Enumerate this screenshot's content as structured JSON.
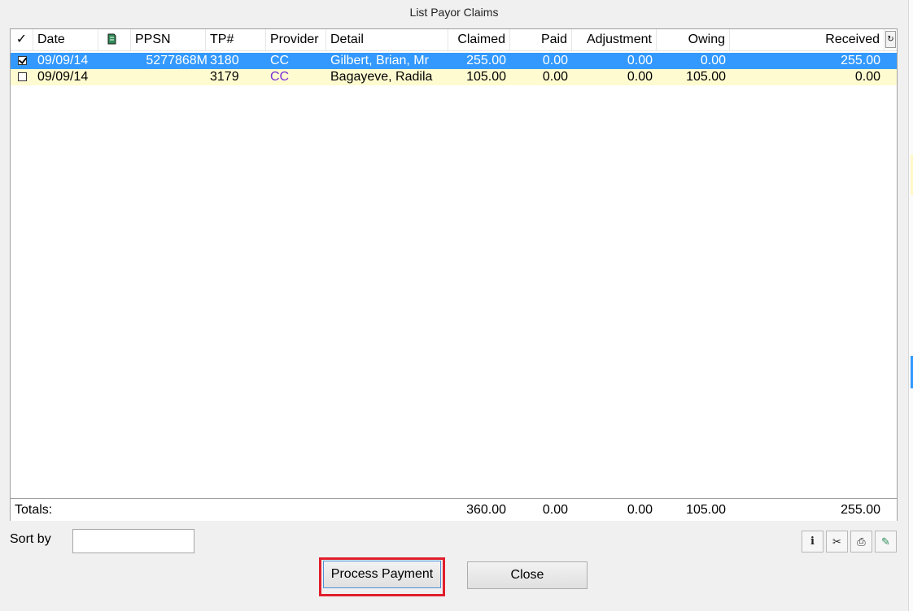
{
  "window": {
    "title": "List Payor Claims"
  },
  "columns": {
    "check": "✓",
    "date": "Date",
    "icon": "note-icon",
    "ppsn": "PPSN",
    "tp": "TP#",
    "provider": "Provider",
    "detail": "Detail",
    "claimed": "Claimed",
    "paid": "Paid",
    "adjustment": "Adjustment",
    "owing": "Owing",
    "received": "Received"
  },
  "rows": [
    {
      "checked": true,
      "date": "09/09/14",
      "ppsn": "5277868M",
      "tp": "3180",
      "provider": "CC",
      "detail": "Gilbert, Brian, Mr",
      "claimed": "255.00",
      "paid": "0.00",
      "adjustment": "0.00",
      "owing": "0.00",
      "received": "255.00",
      "selected": true
    },
    {
      "checked": false,
      "date": "09/09/14",
      "ppsn": "",
      "tp": "3179",
      "provider": "CC",
      "detail": "Bagayeve, Radila",
      "claimed": "105.00",
      "paid": "0.00",
      "adjustment": "0.00",
      "owing": "105.00",
      "received": "0.00",
      "selected": false
    }
  ],
  "totals": {
    "label": "Totals:",
    "claimed": "360.00",
    "paid": "0.00",
    "adjustment": "0.00",
    "owing": "105.00",
    "received": "255.00"
  },
  "sort": {
    "label": "Sort by",
    "value": ""
  },
  "toolbar": [
    {
      "name": "info-icon",
      "glyph": "i"
    },
    {
      "name": "scissors-icon",
      "glyph": "✂"
    },
    {
      "name": "printer-icon",
      "glyph": "⎙"
    },
    {
      "name": "edit-notes-icon",
      "glyph": "✎"
    }
  ],
  "buttons": {
    "process": "Process Payment",
    "close": "Close"
  },
  "colors": {
    "selection": "#3399ff",
    "row_alt": "#fffbd0",
    "highlight": "#e01e2c",
    "provider": "#7b2fd6"
  }
}
